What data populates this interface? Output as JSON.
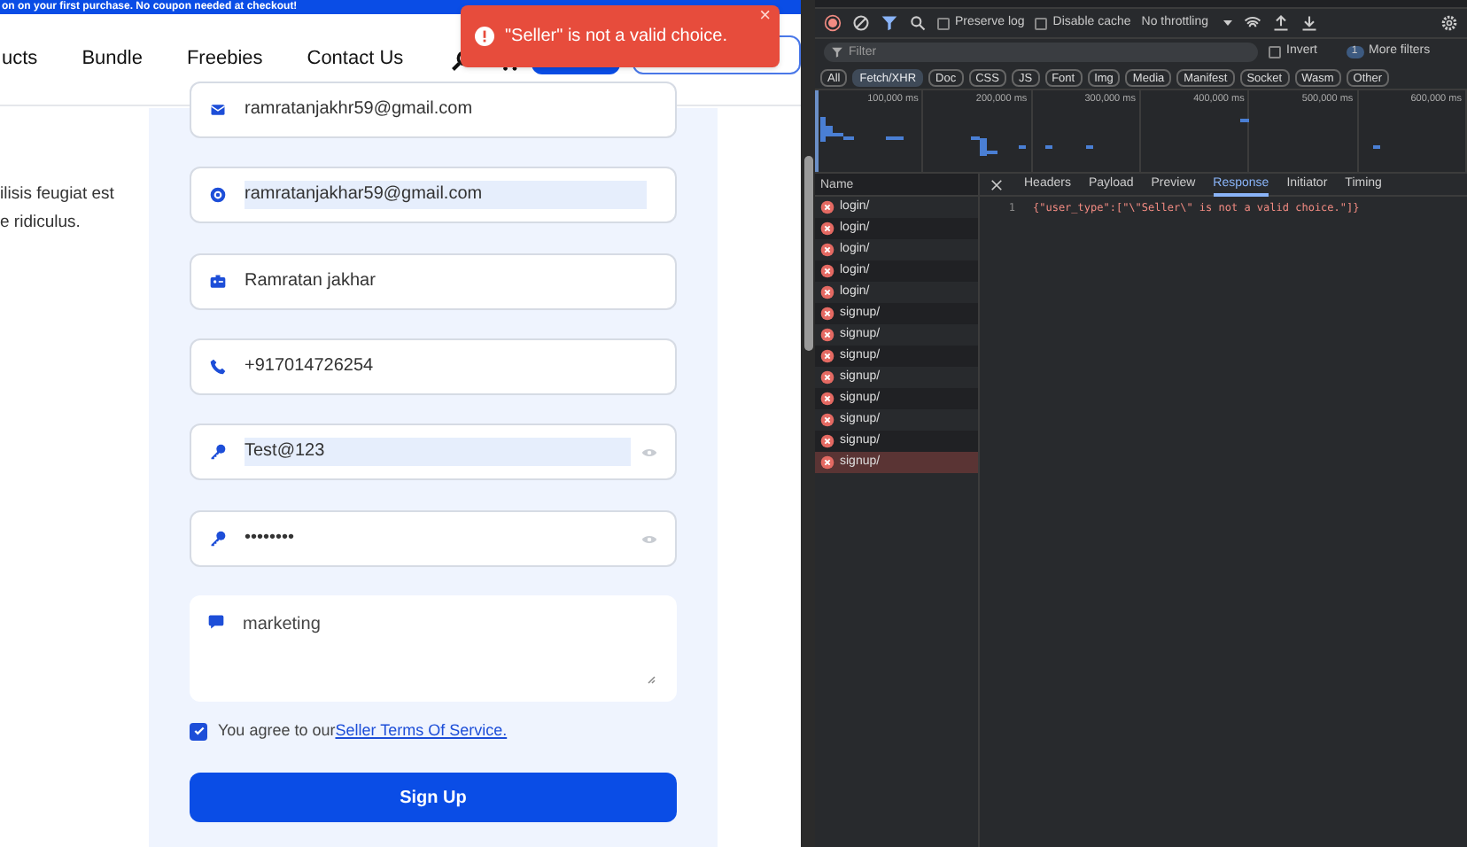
{
  "banner": {
    "text": "on on your first purchase. No coupon needed at checkout!"
  },
  "nav": {
    "links": [
      "ucts",
      "Bundle",
      "Freebies",
      "Contact Us"
    ]
  },
  "toast": {
    "message": "\"Seller\" is not a valid choice.",
    "close": "×"
  },
  "intro": {
    "lines": [
      "ilisis feugiat est",
      "e ridiculus."
    ]
  },
  "form": {
    "fields": [
      {
        "kind": "email",
        "value": "ramratanjakhr59@gmail.com",
        "highlighted": false,
        "eye": false
      },
      {
        "kind": "at",
        "value": "ramratanjakhar59@gmail.com",
        "highlighted": true,
        "eye": false
      },
      {
        "kind": "name",
        "value": "Ramratan jakhar",
        "highlighted": false,
        "eye": false
      },
      {
        "kind": "phone",
        "value": "+917014726254",
        "highlighted": false,
        "eye": false
      },
      {
        "kind": "key",
        "value": "Test@123",
        "highlighted": true,
        "eye": true
      },
      {
        "kind": "key",
        "value": "••••••••",
        "highlighted": false,
        "eye": true
      }
    ],
    "message": "marketing",
    "agree": {
      "checked": true,
      "text": "You agree to our",
      "link": "Seller Terms Of Service."
    },
    "submit": "Sign Up"
  },
  "devtools": {
    "toolbar": {
      "preserve_log": false,
      "preserve_label": "Preserve log",
      "disable_cache": false,
      "disable_label": "Disable cache",
      "throttling": "No throttling"
    },
    "filter": {
      "placeholder": "Filter",
      "invert": false,
      "invert_label": "Invert",
      "more_count": "1",
      "more_label": "More filters"
    },
    "types": [
      {
        "label": "All",
        "selected": false
      },
      {
        "label": "Fetch/XHR",
        "selected": true
      },
      {
        "label": "Doc",
        "selected": false
      },
      {
        "label": "CSS",
        "selected": false
      },
      {
        "label": "JS",
        "selected": false
      },
      {
        "label": "Font",
        "selected": false
      },
      {
        "label": "Img",
        "selected": false
      },
      {
        "label": "Media",
        "selected": false
      },
      {
        "label": "Manifest",
        "selected": false
      },
      {
        "label": "Socket",
        "selected": false
      },
      {
        "label": "Wasm",
        "selected": false
      },
      {
        "label": "Other",
        "selected": false
      }
    ],
    "timeline_ticks": [
      "100,000 ms",
      "200,000 ms",
      "300,000 ms",
      "400,000 ms",
      "500,000 ms",
      "600,000 ms"
    ],
    "name_header": "Name",
    "requests": [
      {
        "name": "login/",
        "selected": false
      },
      {
        "name": "login/",
        "selected": false
      },
      {
        "name": "login/",
        "selected": false
      },
      {
        "name": "login/",
        "selected": false
      },
      {
        "name": "login/",
        "selected": false
      },
      {
        "name": "signup/",
        "selected": false
      },
      {
        "name": "signup/",
        "selected": false
      },
      {
        "name": "signup/",
        "selected": false
      },
      {
        "name": "signup/",
        "selected": false
      },
      {
        "name": "signup/",
        "selected": false
      },
      {
        "name": "signup/",
        "selected": false
      },
      {
        "name": "signup/",
        "selected": false
      },
      {
        "name": "signup/",
        "selected": true
      }
    ],
    "detail_tabs": [
      {
        "label": "Headers",
        "selected": false
      },
      {
        "label": "Payload",
        "selected": false
      },
      {
        "label": "Preview",
        "selected": false
      },
      {
        "label": "Response",
        "selected": true
      },
      {
        "label": "Initiator",
        "selected": false
      },
      {
        "label": "Timing",
        "selected": false
      }
    ],
    "response": [
      {
        "line": "1",
        "code": "{\"user_type\":[\"\\\"Seller\\\" is not a valid choice.\"]}"
      }
    ]
  }
}
